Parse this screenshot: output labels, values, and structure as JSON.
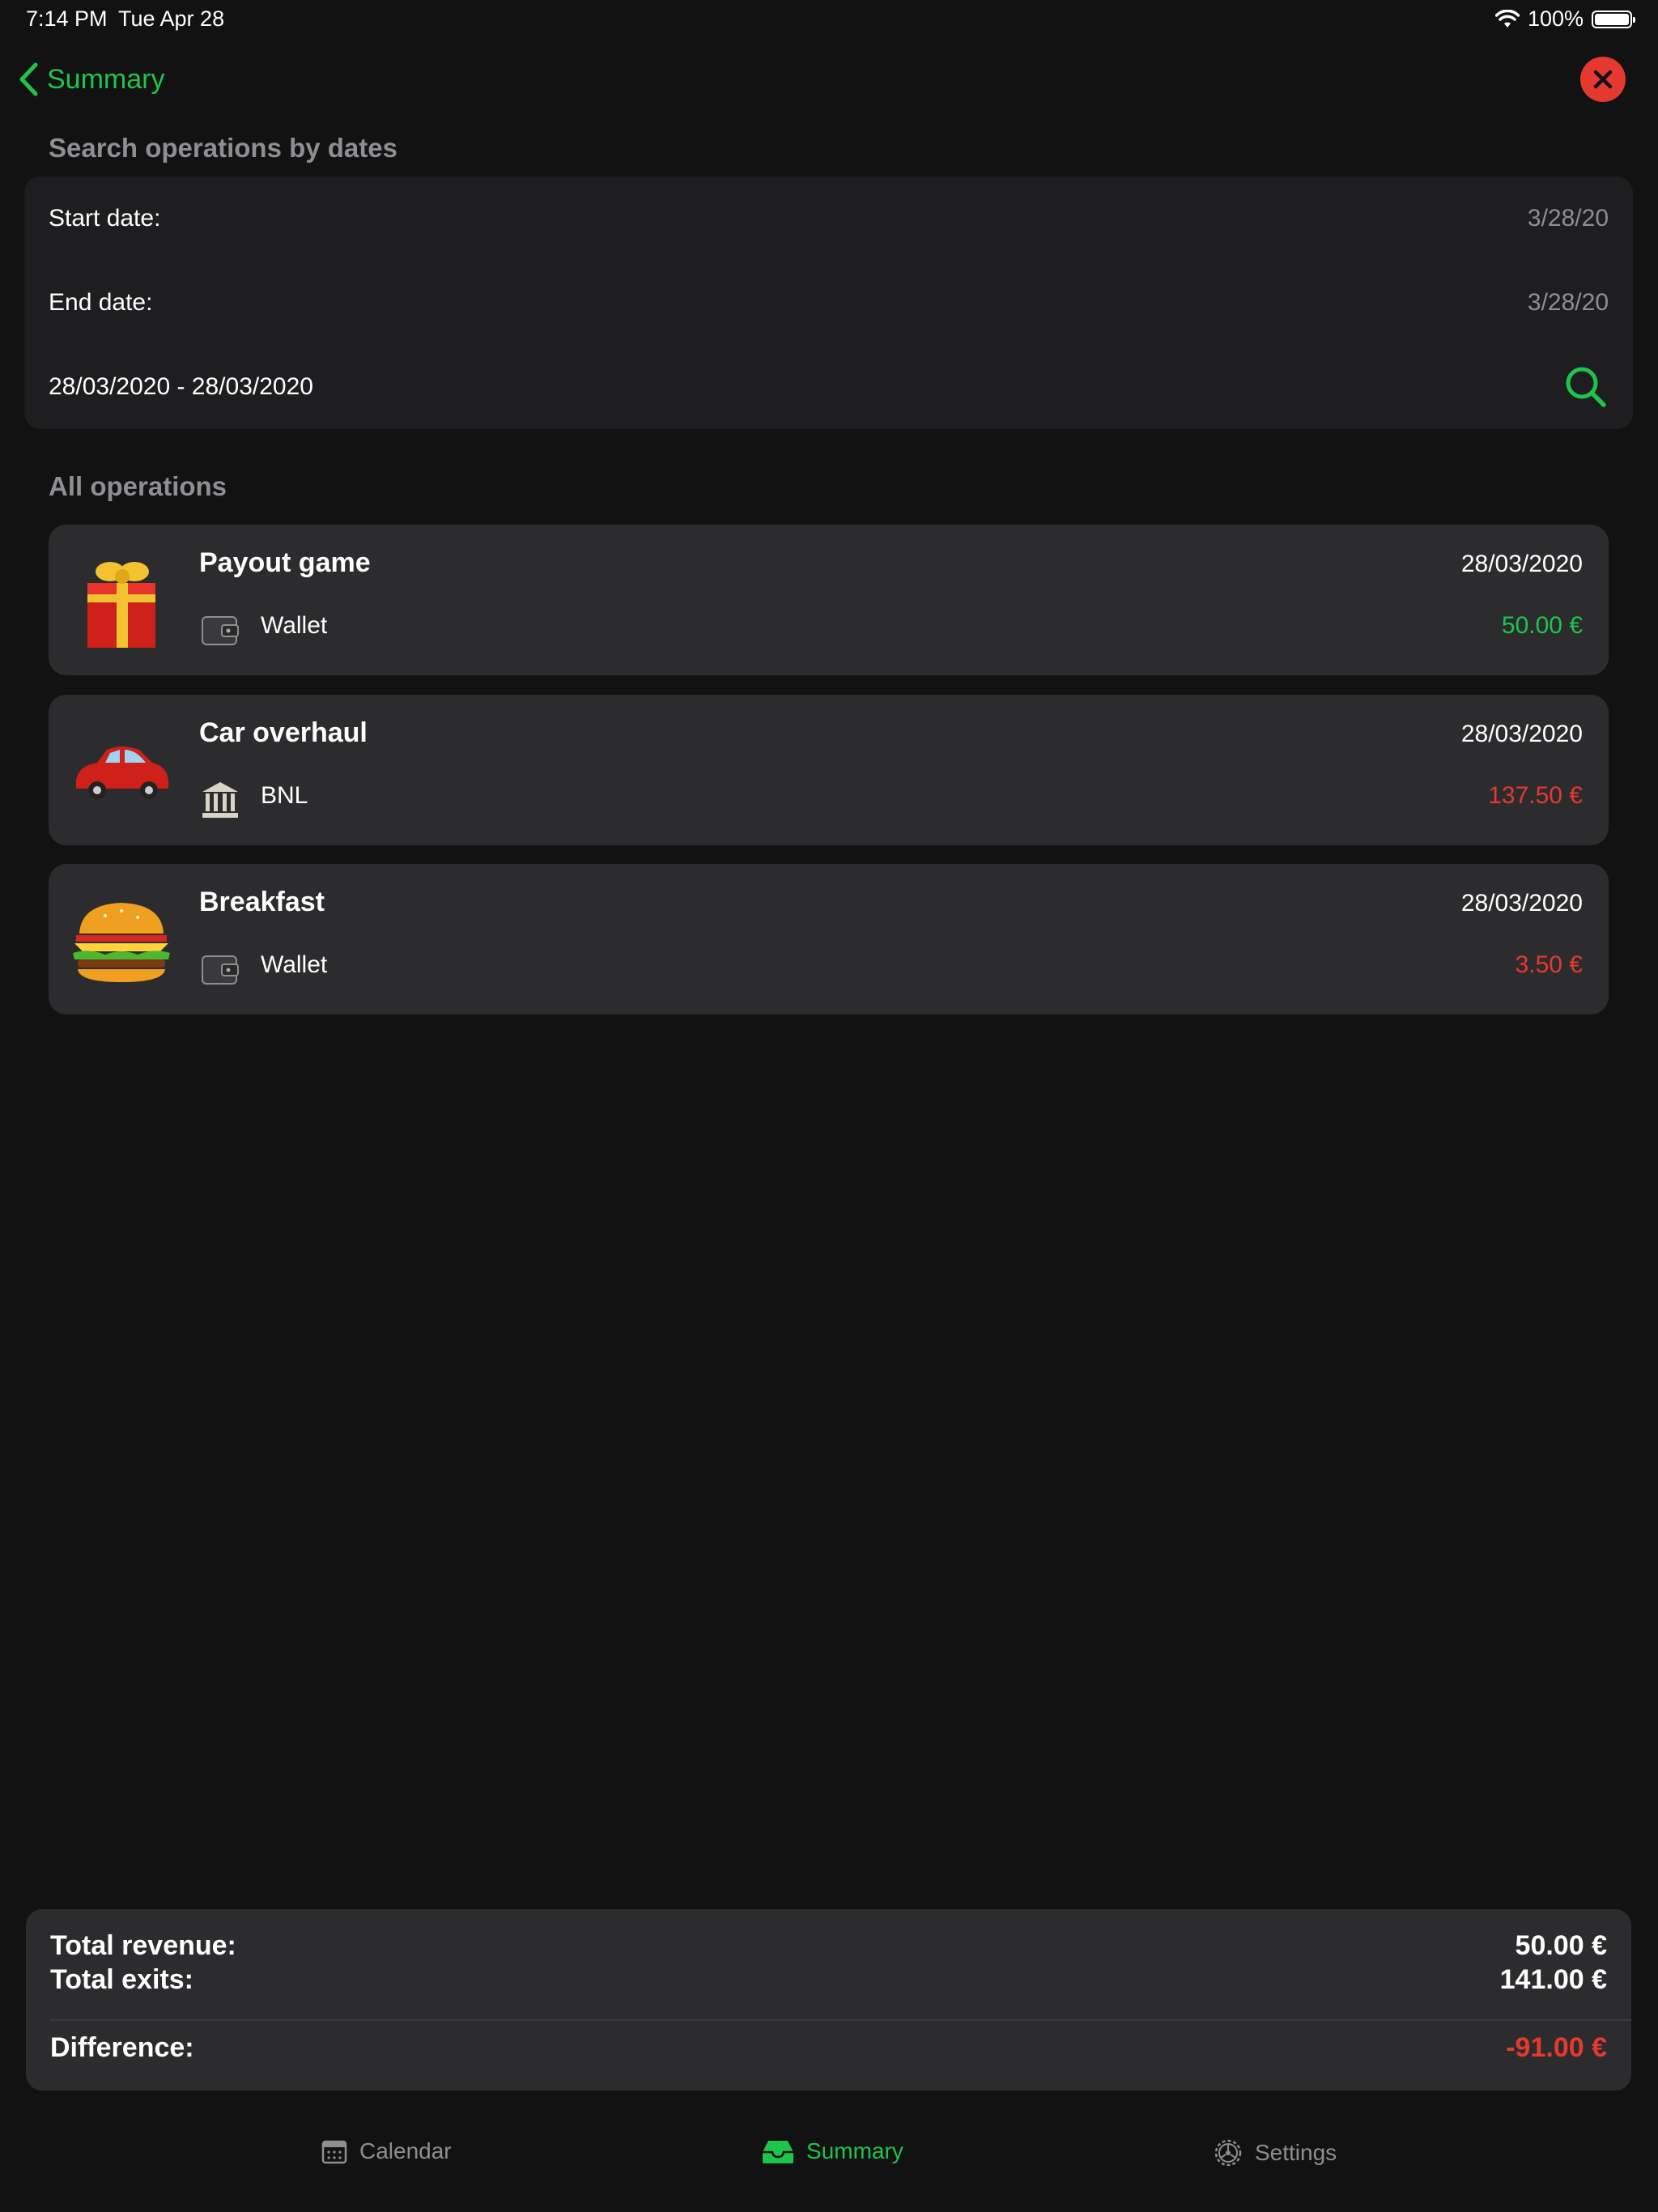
{
  "status_bar": {
    "time": "7:14 PM",
    "date": "Tue Apr 28",
    "battery": "100%"
  },
  "nav": {
    "back_label": "Summary"
  },
  "search": {
    "header": "Search operations by dates",
    "start_label": "Start date:",
    "start_value": "3/28/20",
    "end_label": "End date:",
    "end_value": "3/28/20",
    "range_text": "28/03/2020 - 28/03/2020"
  },
  "operations": {
    "header": "All operations",
    "items": [
      {
        "title": "Payout game",
        "date": "28/03/2020",
        "account": "Wallet",
        "amount": "50.00 €",
        "type": "revenue",
        "thumb": "gift-icon",
        "account_icon": "wallet-icon"
      },
      {
        "title": "Car overhaul",
        "date": "28/03/2020",
        "account": "BNL",
        "amount": "137.50 €",
        "type": "exit",
        "thumb": "car-icon",
        "account_icon": "bank-icon"
      },
      {
        "title": "Breakfast",
        "date": "28/03/2020",
        "account": "Wallet",
        "amount": "3.50 €",
        "type": "exit",
        "thumb": "burger-icon",
        "account_icon": "wallet-icon"
      }
    ]
  },
  "totals": {
    "revenue_label": "Total revenue:",
    "revenue_value": "50.00 €",
    "exits_label": "Total exits:",
    "exits_value": "141.00 €",
    "difference_label": "Difference:",
    "difference_value": "-91.00 €"
  },
  "tabs": [
    {
      "label": "Calendar",
      "icon": "calendar-icon",
      "active": false
    },
    {
      "label": "Summary",
      "icon": "tray-icon",
      "active": true
    },
    {
      "label": "Settings",
      "icon": "gear-icon",
      "active": false
    }
  ],
  "colors": {
    "accent": "#1fc44a",
    "negative": "#e5392f",
    "background": "#121212",
    "card": "#2c2c2e"
  }
}
